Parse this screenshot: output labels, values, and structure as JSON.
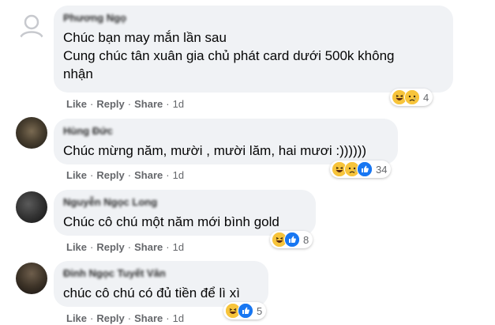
{
  "comments": [
    {
      "author": "Phương Ngọ",
      "lines": [
        "Chúc bạn may mắn lần sau",
        "Cung chúc tân xuân gia chủ phát card dưới 500k không",
        "nhận"
      ],
      "actions": {
        "like": "Like",
        "reply": "Reply",
        "share": "Share",
        "time": "1d"
      },
      "reactions": {
        "icons": [
          "haha-icon",
          "sad-icon"
        ],
        "count": "4"
      }
    },
    {
      "author": "Hùng Đức",
      "lines": [
        "Chúc mừng năm, mười , mười lăm, hai mươi :))))))"
      ],
      "actions": {
        "like": "Like",
        "reply": "Reply",
        "share": "Share",
        "time": "1d"
      },
      "reactions": {
        "icons": [
          "haha-icon",
          "sad-icon",
          "like-icon"
        ],
        "count": "34"
      }
    },
    {
      "author": "Nguyễn Ngọc Long",
      "lines": [
        "Chúc cô chú một năm mới bình gold"
      ],
      "actions": {
        "like": "Like",
        "reply": "Reply",
        "share": "Share",
        "time": "1d"
      },
      "reactions": {
        "icons": [
          "haha-icon",
          "like-icon"
        ],
        "count": "8"
      }
    },
    {
      "author": "Đinh Ngọc Tuyết Vân",
      "lines": [
        "chúc cô chú có đủ tiền để lì xì"
      ],
      "actions": {
        "like": "Like",
        "reply": "Reply",
        "share": "Share",
        "time": "1d"
      },
      "reactions": {
        "icons": [
          "haha-icon",
          "like-icon"
        ],
        "count": "5"
      }
    }
  ],
  "colors": {
    "bubble": "#f0f2f5",
    "meta_text": "#65676b",
    "like_blue": "#1877f2",
    "haha_yellow": "#f7c43b"
  }
}
